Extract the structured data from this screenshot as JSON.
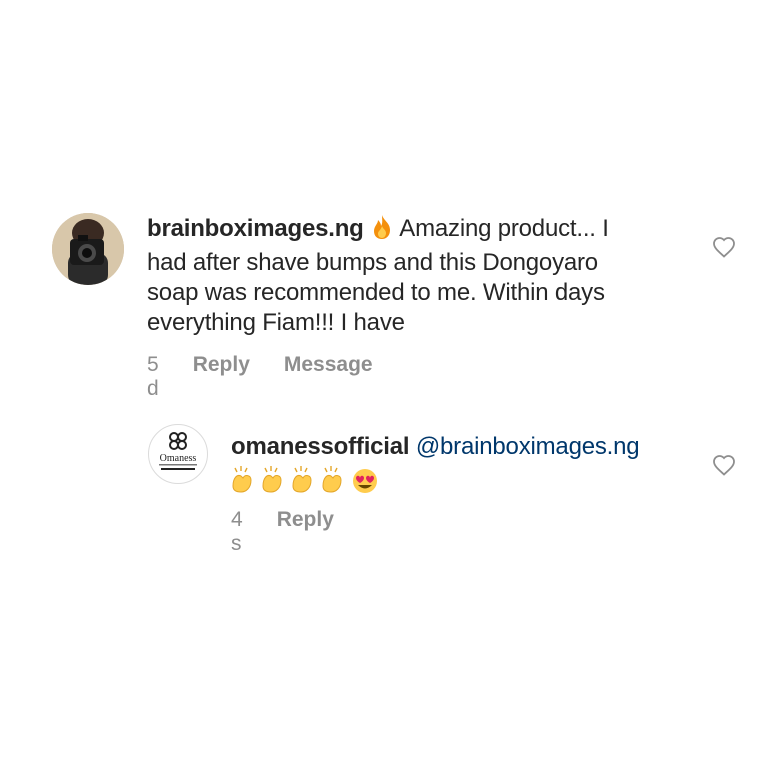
{
  "comments": [
    {
      "username": "brainboximages.ng",
      "text_lines": [
        "Amazing product... I",
        "had after shave bumps and this Dongoyaro",
        "soap was recommended to me. Within days",
        "everything Fiam!!! I have"
      ],
      "time": "5 d",
      "reply_label": "Reply",
      "message_label": "Message",
      "icons": {
        "avatar": "avatar-photo-camera",
        "emoji": "fire-icon",
        "like": "heart-outline-icon"
      }
    },
    {
      "username": "omanessofficial",
      "mention": "@brainboximages.ng",
      "time": "4 s",
      "reply_label": "Reply",
      "avatar_brand": "Omaness",
      "icons": {
        "avatar": "omaness-logo",
        "emoji": "clapping-hands-heart-eyes",
        "like": "heart-outline-icon"
      }
    }
  ]
}
